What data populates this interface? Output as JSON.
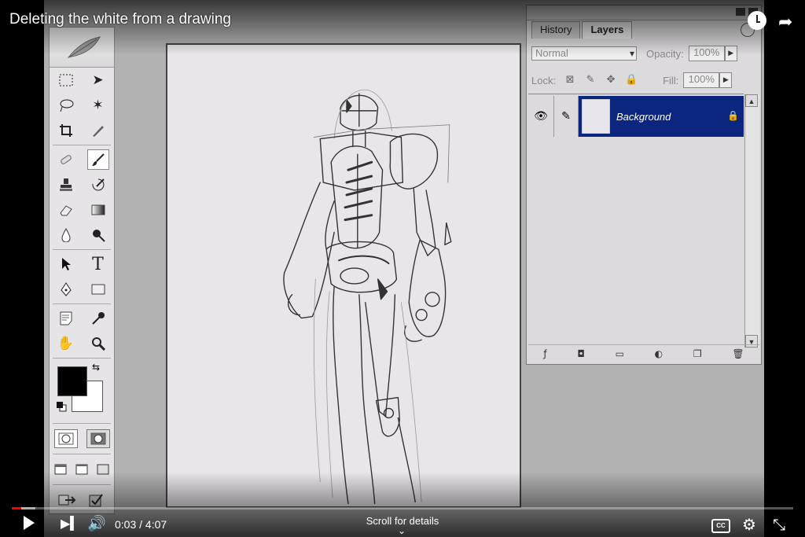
{
  "video": {
    "title": "Deleting the white from a drawing",
    "time_current": "0:03",
    "time_separator": " / ",
    "time_total": "4:07",
    "progress_fraction": 0.012,
    "loaded_fraction": 0.03,
    "scroll_hint": "Scroll for details"
  },
  "photoshop": {
    "panel": {
      "tabs": [
        "History",
        "Layers"
      ],
      "active_tab": "Layers",
      "blend_mode": "Normal",
      "opacity_label": "Opacity:",
      "opacity_value": "100%",
      "lock_label": "Lock:",
      "fill_label": "Fill:",
      "fill_value": "100%",
      "layer_name": "Background"
    },
    "toolbox": {
      "type_tool_label": "T"
    }
  },
  "icons": {
    "share": "share-icon",
    "watch_later": "watch-later-icon",
    "captions": "CC"
  },
  "colors": {
    "progress": "#ff0000",
    "layer_selected": "#0c2680",
    "foreground": "#000000",
    "background": "#ffffff"
  }
}
